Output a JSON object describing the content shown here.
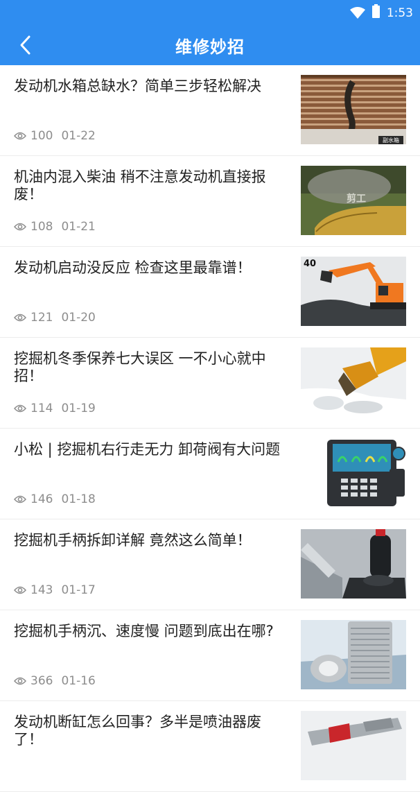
{
  "status": {
    "time": "1:53"
  },
  "header": {
    "title": "维修妙招"
  },
  "articles": [
    {
      "title": "发动机水箱总缺水？简单三步轻松解决",
      "views": "100",
      "date": "01-22",
      "thumb_label": "副水箱"
    },
    {
      "title": "机油内混入柴油 稍不注意发动机直接报废！",
      "views": "108",
      "date": "01-21",
      "thumb_label": "剪工"
    },
    {
      "title": "发动机启动没反应 检查这里最靠谱！",
      "views": "121",
      "date": "01-20",
      "thumb_label": "40"
    },
    {
      "title": "挖掘机冬季保养七大误区 一不小心就中招！",
      "views": "114",
      "date": "01-19"
    },
    {
      "title": "小松 | 挖掘机右行走无力 卸荷阀有大问题",
      "views": "146",
      "date": "01-18"
    },
    {
      "title": "挖掘机手柄拆卸详解 竟然这么简单！",
      "views": "143",
      "date": "01-17"
    },
    {
      "title": "挖掘机手柄沉、速度慢 问题到底出在哪?",
      "views": "366",
      "date": "01-16"
    },
    {
      "title": "发动机断缸怎么回事？多半是喷油器废了！",
      "views": "",
      "date": ""
    }
  ],
  "icons": {
    "back": "chevron-left-icon",
    "wifi": "wifi-icon",
    "battery": "battery-icon",
    "views": "eye-icon"
  },
  "colors": {
    "primary": "#2f8df0",
    "meta": "#8d8d8d",
    "title": "#222222"
  }
}
